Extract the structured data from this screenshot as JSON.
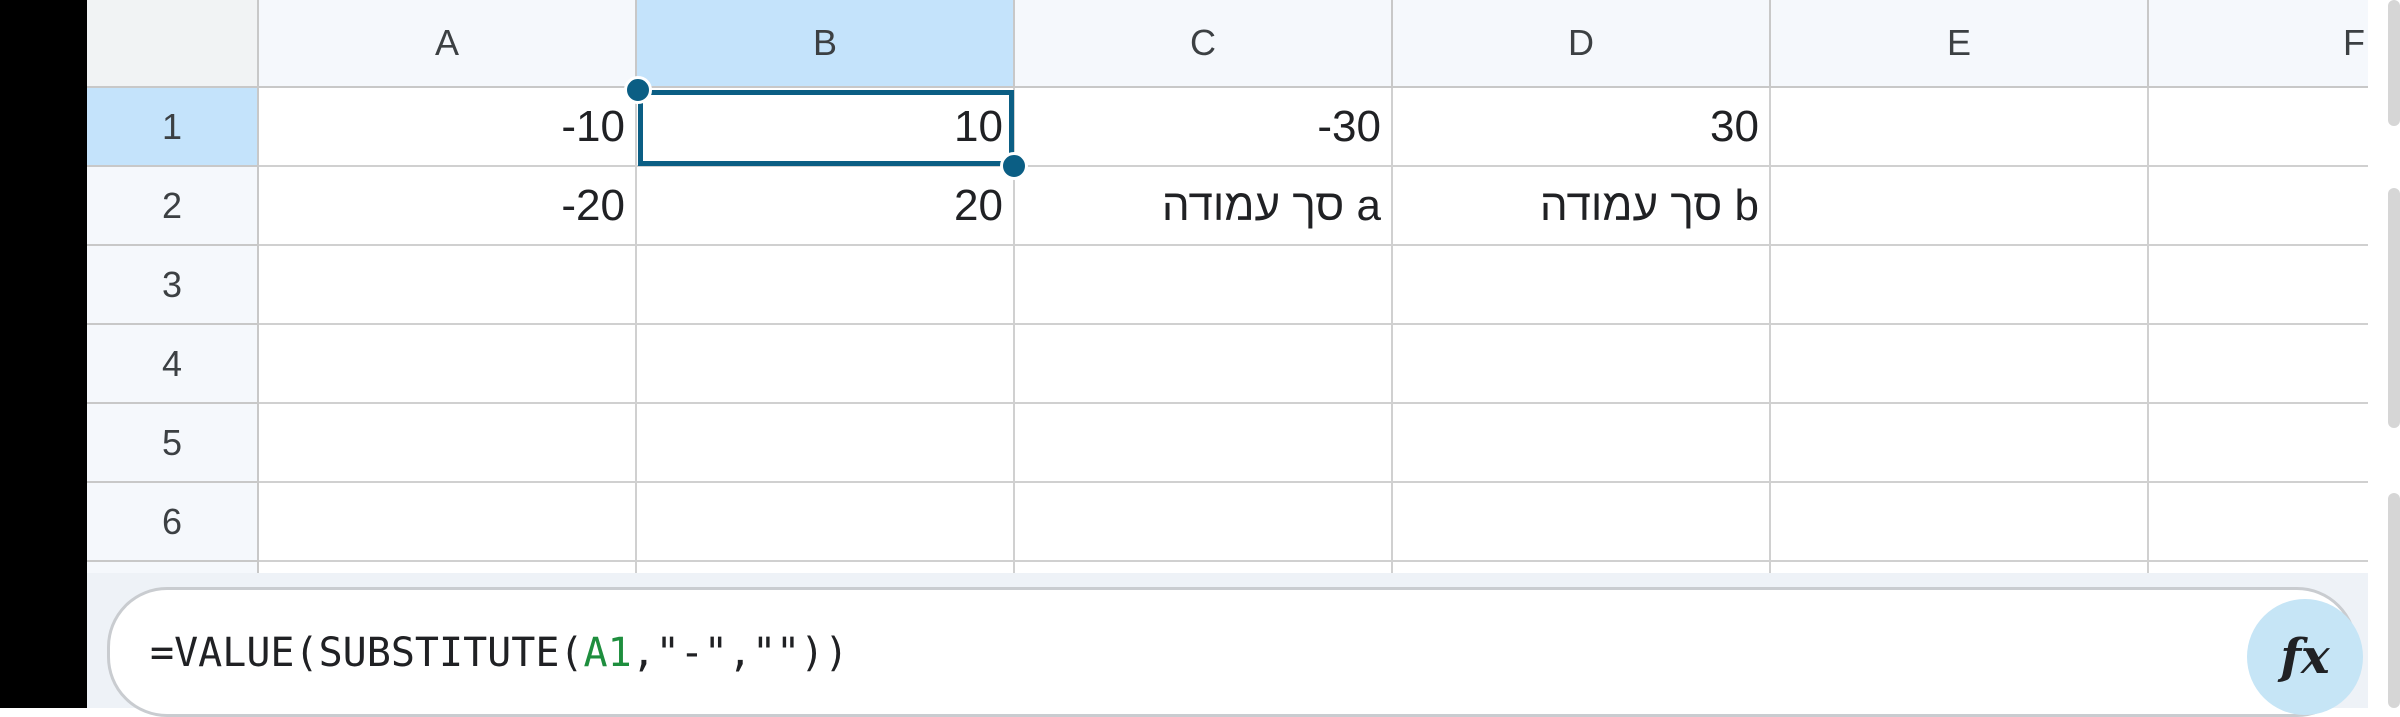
{
  "sheet": {
    "columns": [
      "A",
      "B",
      "C",
      "D",
      "E",
      "F"
    ],
    "rows": [
      "1",
      "2",
      "3",
      "4",
      "5",
      "6"
    ],
    "selected_column": "B",
    "selected_row": "1",
    "cells": {
      "A1": "-10",
      "B1": "10",
      "C1": "-30",
      "D1": "30",
      "A2": "-20",
      "B2": "20",
      "C2": "סך עמודה a",
      "D2": "סך עמודה b"
    }
  },
  "formula_bar": {
    "tok1": "=VALUE(SUBSTITUTE(",
    "tok_ref": "A1",
    "tok2": ",\"-\",\"\"))",
    "fx_label": "fx"
  },
  "colors": {
    "selection": "#0b5e84",
    "header_selected": "#c4e3fb",
    "reference": "#1e8e3e"
  }
}
